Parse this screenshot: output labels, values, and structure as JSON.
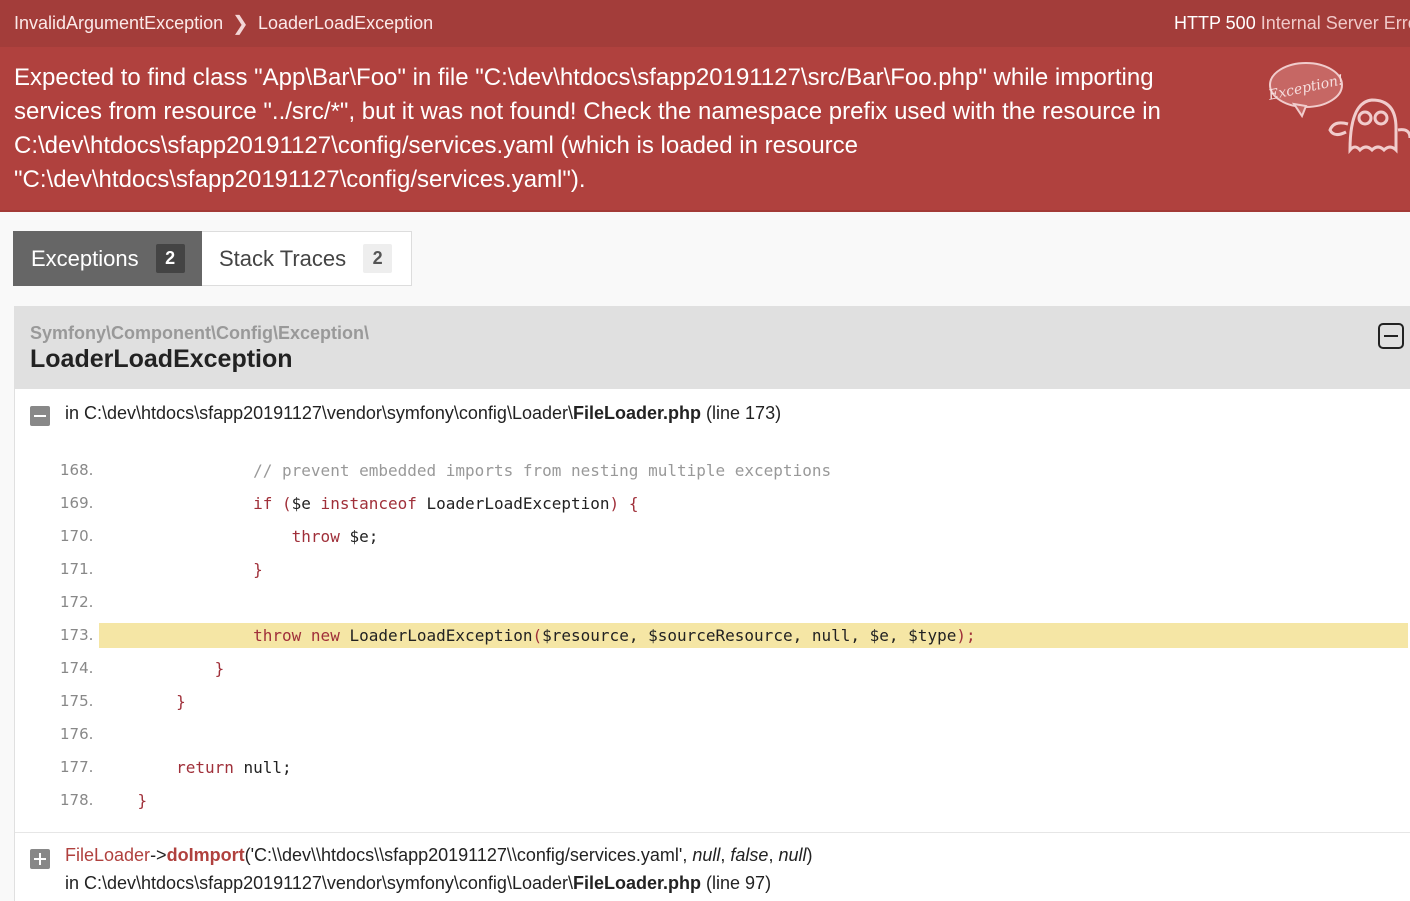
{
  "breadcrumb": {
    "items": [
      "InvalidArgumentException",
      "LoaderLoadException"
    ],
    "separator": "❯"
  },
  "http_status": {
    "code": "HTTP 500",
    "text": "Internal Server Error"
  },
  "message": "Expected to find class \"App\\Bar\\Foo\" in file \"C:\\dev\\htdocs\\sfapp20191127\\src/Bar\\Foo.php\" while importing services from resource \"../src/*\", but it was not found! Check the namespace prefix used with the resource in C:\\dev\\htdocs\\sfapp20191127\\config/services.yaml (which is loaded in resource \"C:\\dev\\htdocs\\sfapp20191127\\config/services.yaml\").",
  "ghost_badge": "Exception!",
  "tabs": [
    {
      "label": "Exceptions",
      "count": "2",
      "active": true
    },
    {
      "label": "Stack Traces",
      "count": "2",
      "active": false
    }
  ],
  "exception": {
    "namespace": "Symfony\\Component\\Config\\Exception\\",
    "class": "LoaderLoadException",
    "file_prefix": "in C:\\dev\\htdocs\\sfapp20191127\\vendor\\symfony\\config\\Loader\\",
    "file_name": "FileLoader.php",
    "file_line": "(line 173)"
  },
  "code_lines": [
    {
      "num": "168."
    },
    {
      "num": "169."
    },
    {
      "num": "170."
    },
    {
      "num": "171."
    },
    {
      "num": "172."
    },
    {
      "num": "173."
    },
    {
      "num": "174."
    },
    {
      "num": "175."
    },
    {
      "num": "176."
    },
    {
      "num": "177."
    },
    {
      "num": "178."
    }
  ],
  "code_text": {
    "l168": "// prevent embedded imports from nesting multiple exceptions",
    "l169_kw": "if",
    "l169_a": " (",
    "l169_var": "$e",
    "l169_kw2": " instanceof",
    "l169_cls": " LoaderLoadException",
    "l169_b": ") {",
    "l170_kw": "throw",
    "l170_rest": " $e;",
    "l171": "}",
    "l173_kw": "throw new",
    "l173_call": " LoaderLoadException",
    "l173_p1": "(",
    "l173_args": "$resource, $sourceResource, null, $e, $type",
    "l173_p2": ");",
    "l174": "}",
    "l175": "}",
    "l177_kw": "return",
    "l177_rest": " null;",
    "l178": "}"
  },
  "trace": {
    "class": "FileLoader",
    "arrow": "->",
    "function": "doImport",
    "args_open": "('C:\\\\dev\\\\htdocs\\\\sfapp20191127\\\\config/services.yaml', ",
    "arg_null1": "null",
    "comma1": ", ",
    "arg_false": "false",
    "comma2": ", ",
    "arg_null2": "null",
    "args_close": ")",
    "file_prefix": "in C:\\dev\\htdocs\\sfapp20191127\\vendor\\symfony\\config\\Loader\\",
    "file_name": "FileLoader.php",
    "file_line": "(line 97)"
  }
}
